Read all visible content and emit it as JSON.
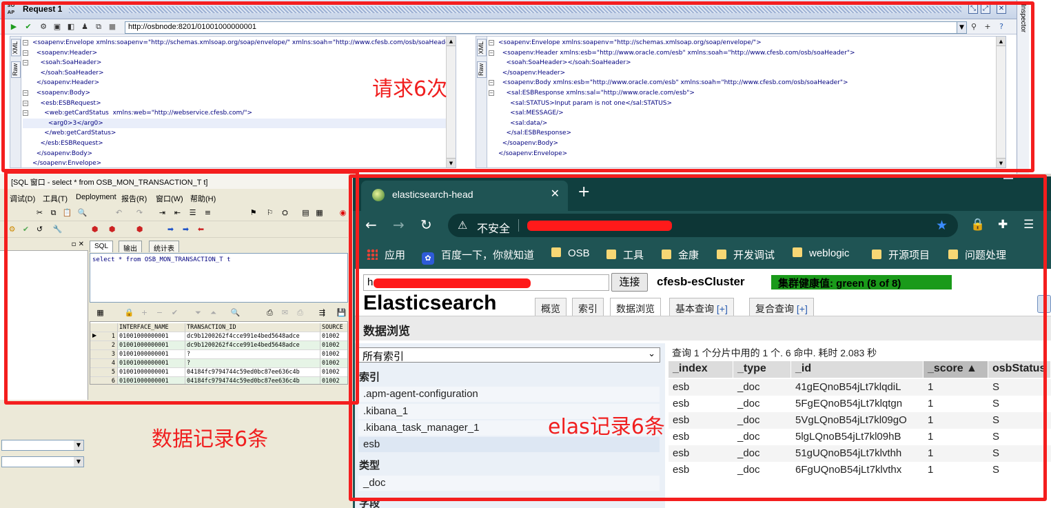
{
  "soapui": {
    "title": "Request 1",
    "logo_text": "SO AP",
    "url": "http://osbnode:8201/01001000000001",
    "inspector_label": "Inspector",
    "tab_xml": "XML",
    "tab_raw": "Raw",
    "request_xml": [
      "<soapenv:Envelope xmlns:soapenv=\"http://schemas.xmlsoap.org/soap/envelope/\" xmlns:soah=\"http://www.cfesb.com/osb/soaHeader\" xmlns",
      "  <soapenv:Header>",
      "    <soah:SoaHeader>",
      "    </soah:SoaHeader>",
      "  </soapenv:Header>",
      "  <soapenv:Body>",
      "    <esb:ESBRequest>",
      "      <web:getCardStatus  xmlns:web=\"http://webservice.cfesb.com/\">",
      "        <arg0>3</arg0>",
      "      </web:getCardStatus>",
      "    </esb:ESBRequest>",
      "  </soapenv:Body>",
      "</soapenv:Envelope>"
    ],
    "response_xml": [
      "<soapenv:Envelope xmlns:soapenv=\"http://schemas.xmlsoap.org/soap/envelope/\">",
      "  <soapenv:Header xmlns:esb=\"http://www.oracle.com/esb\" xmlns:soah=\"http://www.cfesb.com/osb/soaHeader\">",
      "    <soah:SoaHeader></soah:SoaHeader>",
      "  </soapenv:Header>",
      "  <soapenv:Body xmlns:esb=\"http://www.oracle.com/esb\" xmlns:soah=\"http://www.cfesb.com/osb/soaHeader\">",
      "    <sal:ESBResponse xmlns:sal=\"http://www.oracle.com/esb\">",
      "      <sal:STATUS>Input param is not one</sal:STATUS>",
      "      <sal:MESSAGE/>",
      "      <sal:data/>",
      "    </sal:ESBResponse>",
      "  </soapenv:Body>",
      "</soapenv:Envelope>"
    ]
  },
  "annotations": {
    "requests": "请求6次",
    "db_records": "数据记录6条",
    "es_records": "elas记录6条"
  },
  "plsql": {
    "title": "[SQL 窗口 - select * from OSB_MON_TRANSACTION_T t]",
    "menu": [
      "调试(D)",
      "工具(T)",
      "Deployment",
      "报告(R)",
      "窗口(W)",
      "帮助(H)"
    ],
    "tabs": [
      "SQL",
      "输出",
      "统计表"
    ],
    "sql": "select *   from OSB_MON_TRANSACTION_T t",
    "grid_columns": [
      "INTERFACE_NAME",
      "TRANSACTION_ID",
      "SOURCE"
    ],
    "grid_rows": [
      {
        "n": "1",
        "iface": "01001000000001",
        "tx": "dc9b1200262f4cce991e4bed5648adce",
        "src": "01002"
      },
      {
        "n": "2",
        "iface": "01001000000001",
        "tx": "dc9b1200262f4cce991e4bed5648adce",
        "src": "01002"
      },
      {
        "n": "3",
        "iface": "01001000000001",
        "tx": "?",
        "src": "01002"
      },
      {
        "n": "4",
        "iface": "01001000000001",
        "tx": "?",
        "src": "01002"
      },
      {
        "n": "5",
        "iface": "01001000000001",
        "tx": "04184fc9794744c59ed0bc87ee636c4b",
        "src": "01002"
      },
      {
        "n": "6",
        "iface": "01001000000001",
        "tx": "04184fc9794744c59ed0bc87ee636c4b",
        "src": "01002"
      }
    ]
  },
  "chrome": {
    "tab_title": "elasticsearch-head",
    "insecure_label": "不安全",
    "bookmarks": [
      "应用",
      "百度一下，你就知道",
      "OSB",
      "工具",
      "金康",
      "开发调试",
      "weblogic",
      "开源项目",
      "问题处理"
    ],
    "colors": {
      "frame": "#1f5454",
      "health": "#1a9a1a",
      "redact": "#ff1a1a",
      "annotation": "#f01f1f"
    }
  },
  "es": {
    "connect_value": "h",
    "connect_button": "连接",
    "cluster_name": "cfesb-esCluster",
    "health": "集群健康值: green (8 of 8)",
    "logo": "Elasticsearch",
    "tabs": [
      {
        "label": "概览",
        "plus": ""
      },
      {
        "label": "索引",
        "plus": ""
      },
      {
        "label": "数据浏览",
        "plus": ""
      },
      {
        "label": "基本查询 ",
        "plus": "[+]"
      },
      {
        "label": "复合查询 ",
        "plus": "[+]"
      }
    ],
    "section_title": "数据浏览",
    "index_select": "所有索引",
    "indices_heading": "索引",
    "indices": [
      ".apm-agent-configuration",
      ".kibana_1",
      ".kibana_task_manager_1",
      "esb"
    ],
    "types_heading": "类型",
    "types": [
      "_doc"
    ],
    "fields_heading": "字段",
    "result_info": "查询 1 个分片中用的 1 个. 6 命中. 耗时 2.083 秒",
    "columns": [
      "_index",
      "_type",
      "_id",
      "_score ▲",
      "osbStatus"
    ],
    "rows": [
      {
        "index": "esb",
        "type": "_doc",
        "id": "41gEQnoB54jLt7klqdiL",
        "score": "1",
        "status": "S"
      },
      {
        "index": "esb",
        "type": "_doc",
        "id": "5FgEQnoB54jLt7klqtgn",
        "score": "1",
        "status": "S"
      },
      {
        "index": "esb",
        "type": "_doc",
        "id": "5VgLQnoB54jLt7kl09gO",
        "score": "1",
        "status": "S"
      },
      {
        "index": "esb",
        "type": "_doc",
        "id": "5lgLQnoB54jLt7kl09hB",
        "score": "1",
        "status": "S"
      },
      {
        "index": "esb",
        "type": "_doc",
        "id": "51gUQnoB54jLt7klvthh",
        "score": "1",
        "status": "S"
      },
      {
        "index": "esb",
        "type": "_doc",
        "id": "6FgUQnoB54jLt7klvthx",
        "score": "1",
        "status": "S"
      }
    ]
  }
}
